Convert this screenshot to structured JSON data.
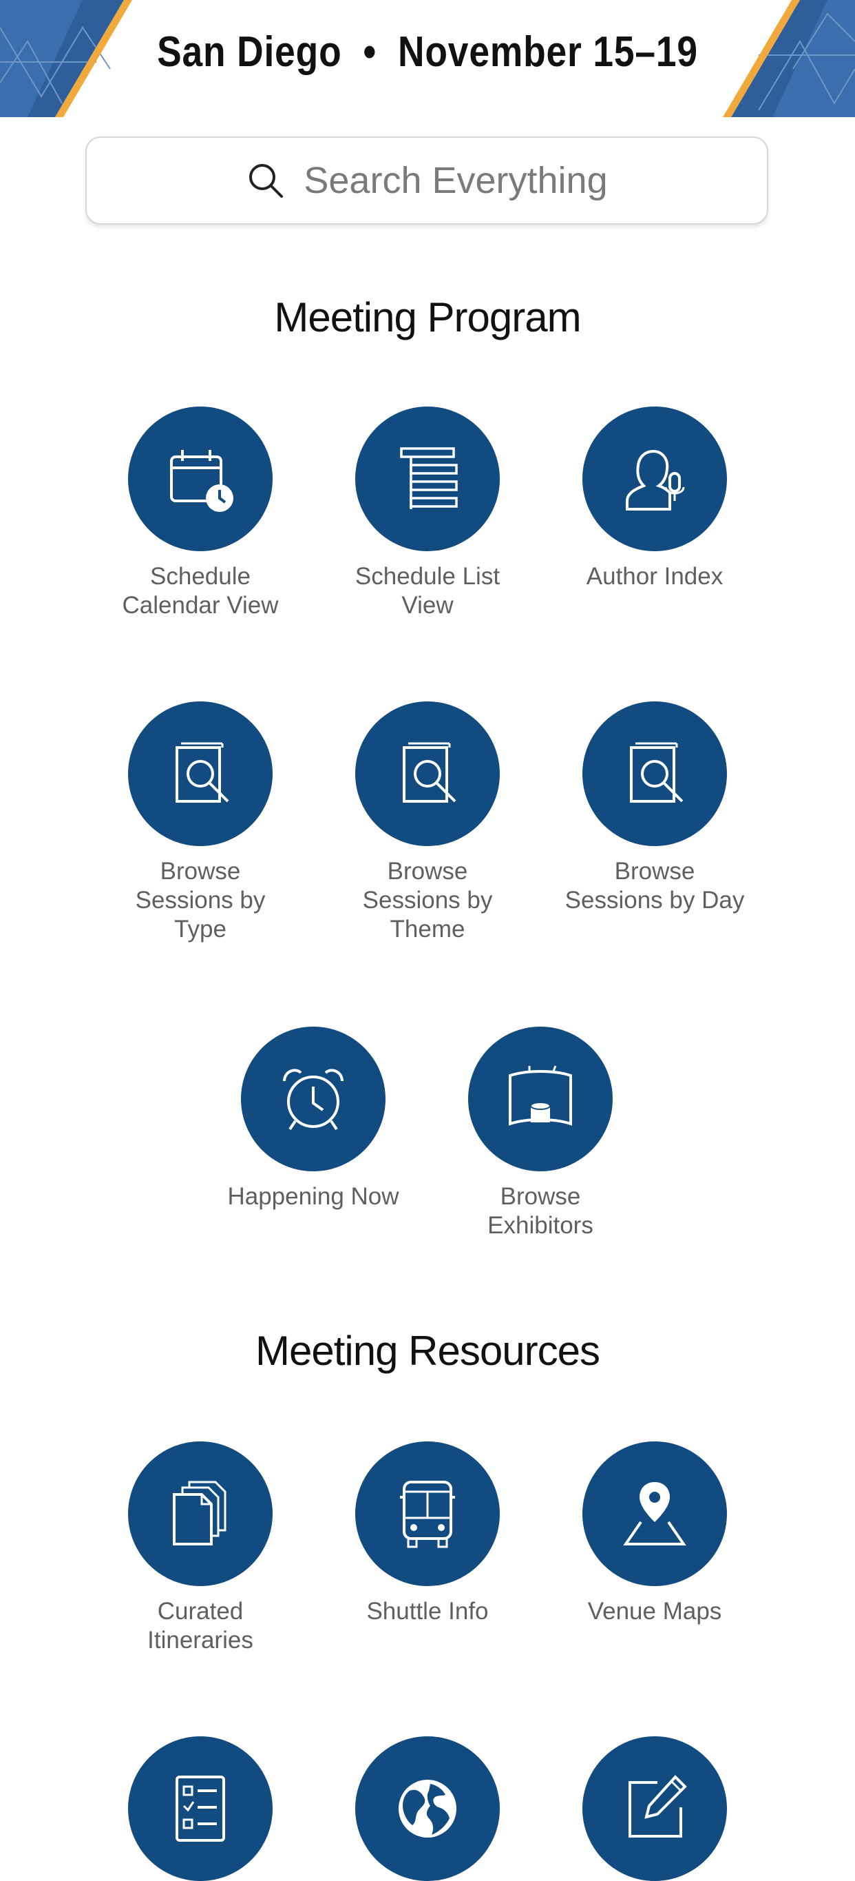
{
  "header": {
    "city": "San Diego",
    "separator": "•",
    "dates": "November 15–19",
    "colors": {
      "banner_blue": "#2f5f9a",
      "accent_gold": "#f2a93b"
    }
  },
  "search": {
    "placeholder": "Search Everything"
  },
  "meeting_program": {
    "title": "Meeting Program",
    "tiles": [
      {
        "label_line1": "Schedule",
        "label_line2": "Calendar View",
        "icon": "calendar-clock-icon"
      },
      {
        "label_line1": "Schedule List",
        "label_line2": "View",
        "icon": "list-icon"
      },
      {
        "label_line1": "Author Index",
        "label_line2": "",
        "icon": "author-microphone-icon"
      },
      {
        "label_line1": "Browse",
        "label_line2": "Sessions by",
        "label_line3": "Type",
        "icon": "book-search-icon"
      },
      {
        "label_line1": "Browse",
        "label_line2": "Sessions by",
        "label_line3": "Theme",
        "icon": "book-search-icon"
      },
      {
        "label_line1": "Browse",
        "label_line2": "Sessions by Day",
        "icon": "book-search-icon"
      },
      {
        "label_line1": "Happening Now",
        "label_line2": "",
        "icon": "alarm-clock-icon"
      },
      {
        "label_line1": "Browse",
        "label_line2": "Exhibitors",
        "icon": "exhibitor-booth-icon"
      }
    ]
  },
  "meeting_resources": {
    "title": "Meeting Resources",
    "tiles": [
      {
        "label_line1": "Curated",
        "label_line2": "Itineraries",
        "icon": "documents-icon"
      },
      {
        "label_line1": "Shuttle Info",
        "label_line2": "",
        "icon": "bus-icon"
      },
      {
        "label_line1": "Venue Maps",
        "label_line2": "",
        "icon": "map-pin-icon"
      },
      {
        "label_line1": "",
        "label_line2": "",
        "icon": "checklist-icon"
      },
      {
        "label_line1": "",
        "label_line2": "",
        "icon": "globe-icon"
      },
      {
        "label_line1": "",
        "label_line2": "",
        "icon": "edit-note-icon"
      }
    ]
  },
  "theme": {
    "tile_color": "#114b7f",
    "label_color": "#5f5f5f"
  }
}
